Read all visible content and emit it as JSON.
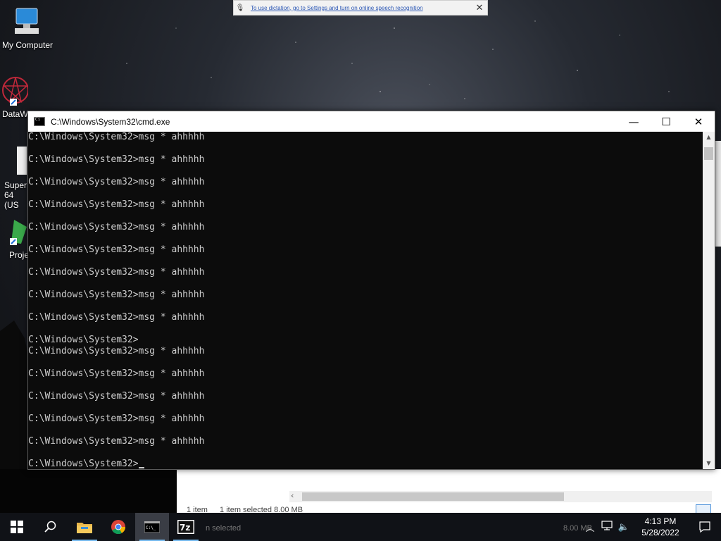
{
  "desktop": {
    "icons": [
      {
        "label": "My Computer"
      },
      {
        "label": "DataW"
      },
      {
        "label": "Super"
      },
      {
        "label": "64 (US"
      },
      {
        "label": "Proje"
      }
    ]
  },
  "toast": {
    "message": "To use dictation, go to Settings and turn on online speech recognition",
    "close": "✕"
  },
  "cmd": {
    "title": "C:\\Windows\\System32\\cmd.exe",
    "minimize": "—",
    "maximize": "☐",
    "close": "✕",
    "lines": [
      "C:\\Windows\\System32>msg * ahhhhh",
      "",
      "C:\\Windows\\System32>msg * ahhhhh",
      "",
      "C:\\Windows\\System32>msg * ahhhhh",
      "",
      "C:\\Windows\\System32>msg * ahhhhh",
      "",
      "C:\\Windows\\System32>msg * ahhhhh",
      "",
      "C:\\Windows\\System32>msg * ahhhhh",
      "",
      "C:\\Windows\\System32>msg * ahhhhh",
      "",
      "C:\\Windows\\System32>msg * ahhhhh",
      "",
      "C:\\Windows\\System32>msg * ahhhhh",
      "",
      "C:\\Windows\\System32>",
      "C:\\Windows\\System32>msg * ahhhhh",
      "",
      "C:\\Windows\\System32>msg * ahhhhh",
      "",
      "C:\\Windows\\System32>msg * ahhhhh",
      "",
      "C:\\Windows\\System32>msg * ahhhhh",
      "",
      "C:\\Windows\\System32>msg * ahhhhh",
      ""
    ],
    "prompt": "C:\\Windows\\System32>"
  },
  "explorer": {
    "status_items": "1 item",
    "status_selected": "1 item selected  8.00 MB",
    "status_behind": "n selected",
    "size_behind": "8.00 MB"
  },
  "taskbar": {
    "icons": [
      "windows-start-icon",
      "search-icon",
      "file-explorer-icon",
      "chrome-icon",
      "cmd-icon",
      "7zip-icon"
    ],
    "time": "4:13 PM",
    "date": "5/28/2022"
  }
}
